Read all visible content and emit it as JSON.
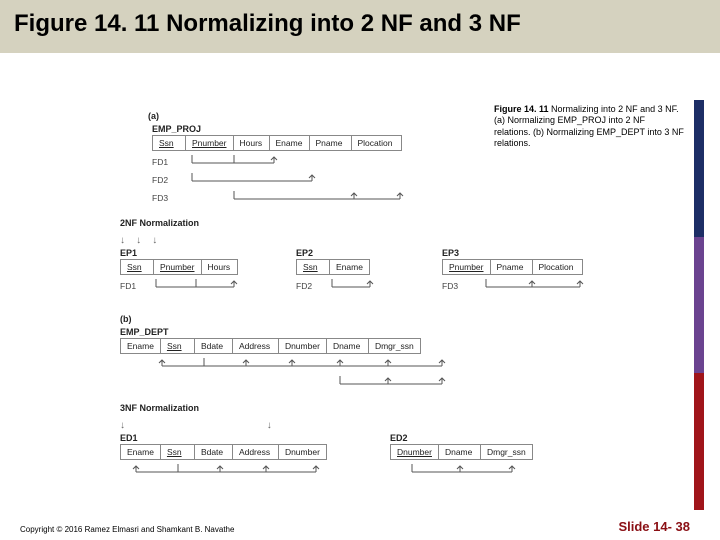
{
  "title": "Figure 14. 11 Normalizing into 2 NF and 3 NF",
  "caption": {
    "heading": "Figure 14. 11",
    "body": "Normalizing into 2 NF and 3 NF. (a) Normalizing EMP_PROJ into 2 NF relations. (b) Normalizing EMP_DEPT into 3 NF relations."
  },
  "part_a": {
    "label": "(a)",
    "relation": "EMP_PROJ",
    "cols": [
      "Ssn",
      "Pnumber",
      "Hours",
      "Ename",
      "Pname",
      "Plocation"
    ],
    "fds": [
      "FD1",
      "FD2",
      "FD3"
    ],
    "norm_label": "2NF Normalization",
    "ep1": {
      "name": "EP1",
      "cols": [
        "Ssn",
        "Pnumber",
        "Hours"
      ],
      "fd": "FD1"
    },
    "ep2": {
      "name": "EP2",
      "cols": [
        "Ssn",
        "Ename"
      ],
      "fd": "FD2"
    },
    "ep3": {
      "name": "EP3",
      "cols": [
        "Pnumber",
        "Pname",
        "Plocation"
      ],
      "fd": "FD3"
    }
  },
  "part_b": {
    "label": "(b)",
    "relation": "EMP_DEPT",
    "cols": [
      "Ename",
      "Ssn",
      "Bdate",
      "Address",
      "Dnumber",
      "Dname",
      "Dmgr_ssn"
    ],
    "norm_label": "3NF Normalization",
    "ed1": {
      "name": "ED1",
      "cols": [
        "Ename",
        "Ssn",
        "Bdate",
        "Address",
        "Dnumber"
      ]
    },
    "ed2": {
      "name": "ED2",
      "cols": [
        "Dnumber",
        "Dname",
        "Dmgr_ssn"
      ]
    }
  },
  "footer": {
    "copyright": "Copyright © 2016 Ramez Elmasri and Shamkant B. Navathe",
    "slide": "Slide 14- 38"
  }
}
